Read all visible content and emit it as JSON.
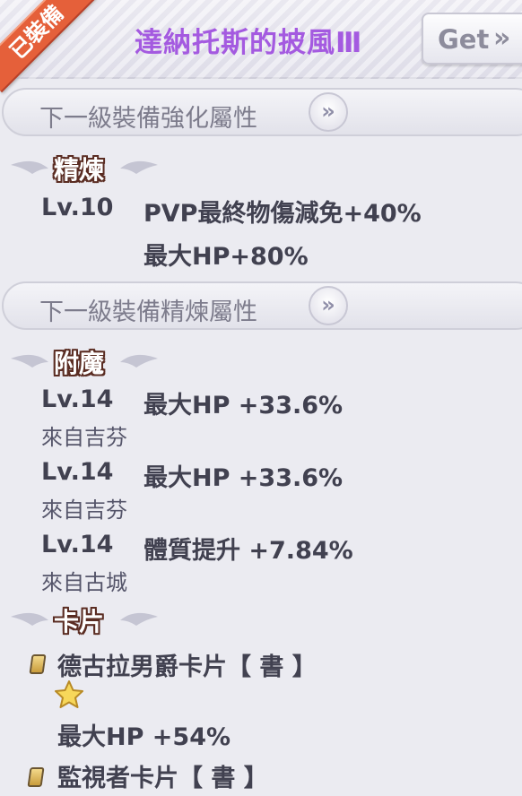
{
  "header": {
    "title": "達納托斯的披風Ⅲ",
    "get_label": "Get",
    "get_chevron": "»",
    "ribbon": "已裝備"
  },
  "sections": [
    {
      "label": "下一級裝備強化屬性",
      "chevron": "»"
    },
    {
      "label": "下一級裝備精煉屬性",
      "chevron": "»"
    }
  ],
  "refine": {
    "title": "精煉",
    "level": "Lv.10",
    "lines": [
      "PVP最終物傷減免+40%",
      "最大HP+80%"
    ]
  },
  "enchant": {
    "title": "附魔",
    "items": [
      {
        "level": "Lv.14",
        "text": "最大HP +33.6%",
        "source": "來自吉芬"
      },
      {
        "level": "Lv.14",
        "text": "最大HP +33.6%",
        "source": "來自吉芬"
      },
      {
        "level": "Lv.14",
        "text": "體質提升 +7.84%",
        "source": "來自古城"
      }
    ]
  },
  "cards": {
    "title": "卡片",
    "items": [
      {
        "name": "德古拉男爵卡片【 書 】",
        "star_icon": "star-icon",
        "effect": "最大HP +54%"
      },
      {
        "name": "監視者卡片【 書 】"
      }
    ]
  },
  "colors": {
    "title": "#a45ae0",
    "ribbon": "#e5603a",
    "panel": "#ebebf1",
    "text": "#414150"
  }
}
